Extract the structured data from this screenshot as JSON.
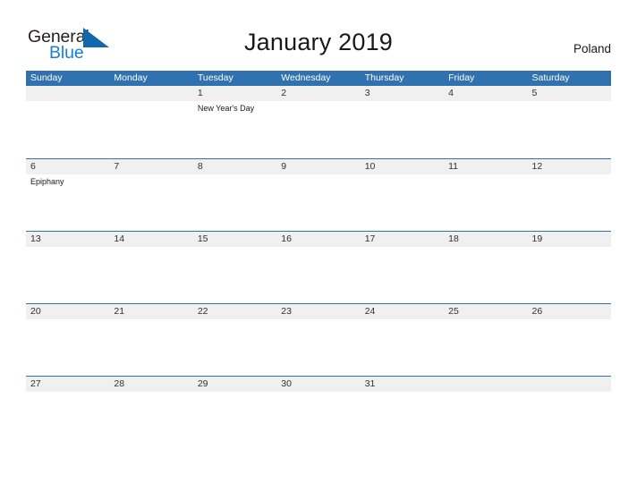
{
  "brand": {
    "line1": "General",
    "line2": "Blue",
    "flag_icon": "blue-triangle-flag-icon",
    "color_dark": "#231f20",
    "color_blue": "#1a7fd4"
  },
  "header": {
    "title": "January 2019",
    "region": "Poland"
  },
  "theme": {
    "header_blue": "#3071b0",
    "date_band_gray": "#f0f0f0",
    "page_background": "#ffffff",
    "text_dark": "#1a1a1a"
  },
  "calendar": {
    "month": "January",
    "year": "2019",
    "weekday_headers": [
      "Sunday",
      "Monday",
      "Tuesday",
      "Wednesday",
      "Thursday",
      "Friday",
      "Saturday"
    ],
    "weeks": [
      {
        "days": [
          {
            "number": "",
            "events": []
          },
          {
            "number": "",
            "events": []
          },
          {
            "number": "1",
            "events": [
              "New Year's Day"
            ]
          },
          {
            "number": "2",
            "events": []
          },
          {
            "number": "3",
            "events": []
          },
          {
            "number": "4",
            "events": []
          },
          {
            "number": "5",
            "events": []
          }
        ]
      },
      {
        "days": [
          {
            "number": "6",
            "events": [
              "Epiphany"
            ]
          },
          {
            "number": "7",
            "events": []
          },
          {
            "number": "8",
            "events": []
          },
          {
            "number": "9",
            "events": []
          },
          {
            "number": "10",
            "events": []
          },
          {
            "number": "11",
            "events": []
          },
          {
            "number": "12",
            "events": []
          }
        ]
      },
      {
        "days": [
          {
            "number": "13",
            "events": []
          },
          {
            "number": "14",
            "events": []
          },
          {
            "number": "15",
            "events": []
          },
          {
            "number": "16",
            "events": []
          },
          {
            "number": "17",
            "events": []
          },
          {
            "number": "18",
            "events": []
          },
          {
            "number": "19",
            "events": []
          }
        ]
      },
      {
        "days": [
          {
            "number": "20",
            "events": []
          },
          {
            "number": "21",
            "events": []
          },
          {
            "number": "22",
            "events": []
          },
          {
            "number": "23",
            "events": []
          },
          {
            "number": "24",
            "events": []
          },
          {
            "number": "25",
            "events": []
          },
          {
            "number": "26",
            "events": []
          }
        ]
      },
      {
        "days": [
          {
            "number": "27",
            "events": []
          },
          {
            "number": "28",
            "events": []
          },
          {
            "number": "29",
            "events": []
          },
          {
            "number": "30",
            "events": []
          },
          {
            "number": "31",
            "events": []
          },
          {
            "number": "",
            "events": []
          },
          {
            "number": "",
            "events": []
          }
        ]
      }
    ]
  }
}
